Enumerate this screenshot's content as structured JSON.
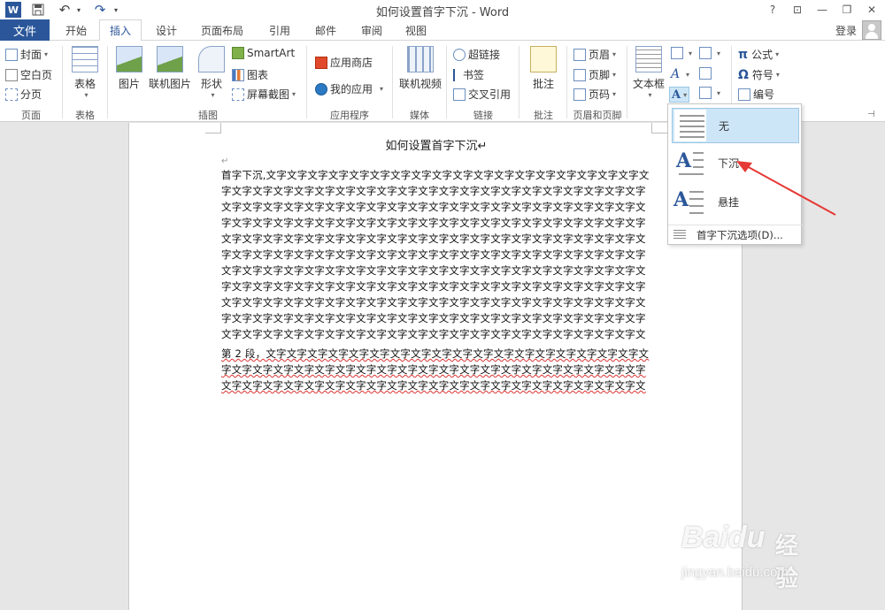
{
  "window": {
    "title": "如何设置首字下沉 - Word",
    "help": "?",
    "restore": "⊡",
    "minimize": "—",
    "maximize": "❐",
    "close": "✕"
  },
  "qat": {
    "undo": "↶",
    "redo": "↷",
    "more": "▾"
  },
  "tabs": [
    "文件",
    "开始",
    "插入",
    "设计",
    "页面布局",
    "引用",
    "邮件",
    "审阅",
    "视图"
  ],
  "active_tab": "插入",
  "login": "登录",
  "ribbon": {
    "pages": {
      "cover": "封面",
      "blank": "空白页",
      "break": "分页",
      "group": "页面"
    },
    "tables": {
      "table": "表格",
      "group": "表格"
    },
    "illustrations": {
      "picture": "图片",
      "online_picture": "联机图片",
      "shapes": "形状",
      "smartart": "SmartArt",
      "chart": "图表",
      "screenshot": "屏幕截图",
      "group": "插图"
    },
    "apps": {
      "store": "应用商店",
      "my_apps": "我的应用",
      "group": "应用程序"
    },
    "media": {
      "online_video": "联机视频",
      "group": "媒体"
    },
    "links": {
      "hyperlink": "超链接",
      "bookmark": "书签",
      "cross_ref": "交叉引用",
      "group": "链接"
    },
    "comments": {
      "comment": "批注",
      "group": "批注"
    },
    "header_footer": {
      "header": "页眉",
      "footer": "页脚",
      "page_number": "页码",
      "group": "页眉和页脚"
    },
    "text": {
      "textbox": "文本框"
    },
    "symbols": {
      "equation": "公式",
      "symbol": "符号",
      "number": "编号",
      "pi": "π",
      "omega": "Ω"
    }
  },
  "document": {
    "title": "如何设置首字下沉↵",
    "blank_mark": "↵",
    "para1": "首字下沉,文字文字文字文字文字文字文字文字文字文字文字文字文字文字文字文字文字文字文字文字文字文字文字文字文字文字文字文字文字文字文字文字文字文字文字文字文字文字文字文字文字文字文字文字文字文字文字文字文字文字文字文字文字文字文字文字文字文字文字文字文字文字文字文字文字文字文字文字文字文字文字文字文字文字文字文字文字文字文字文字文字文字文字文字文字文字文字文字文字文字文字文字文字文字文字文字文字文字文字文字文字文字文字文字文字文字文字文字文字文字文字文字文字文字文字文字文字文字文字文字文字文字文字文字文字文字文字文字文字文字文字文字文字文字文字文字文字文字文字文字文字文字文字文字文字文字文字文字文字文字文字文字文字文字文字文字文字文字文字文字文字文字文字文字文字文字文字文字文字文字文字文字文字文字文字文字文字文字文字文字文字文字文字文字文字文字文字文字文字文字文字文字文字文字文字文字文字文字文字文字文字文字文字文字文字文字文字文字文字文字文字文字文字文字文字文字文字文字文字文字文字文字文字文字文字文字文字文字文字文字文字文字文字文字文字文字文字文字文字文字文字文字文字文字文字文字文字↵",
    "para2": "第 2 段，文字文字文字文字文字文字文字文字文字文字文字文字文字文字文字文字文字文字文字文字文字文字文字文字文字文字文字文字文字文字文字文字文字文字文字文字文字文字文字文字文字文字文字文字文字文字文字文字文字文字文字文字文字文字文字文字文字文字文字文↵"
  },
  "dropcap_menu": {
    "items": [
      {
        "label": "无"
      },
      {
        "label": "下沉"
      },
      {
        "label": "悬挂"
      }
    ],
    "selected": "无",
    "options": "首字下沉选项(D)..."
  },
  "watermark": {
    "brand": "Baidu",
    "brand_cn": "经验",
    "url": "jingyan.baidu.com"
  },
  "colors": {
    "accent": "#2b579a",
    "arrow": "#e53935"
  }
}
